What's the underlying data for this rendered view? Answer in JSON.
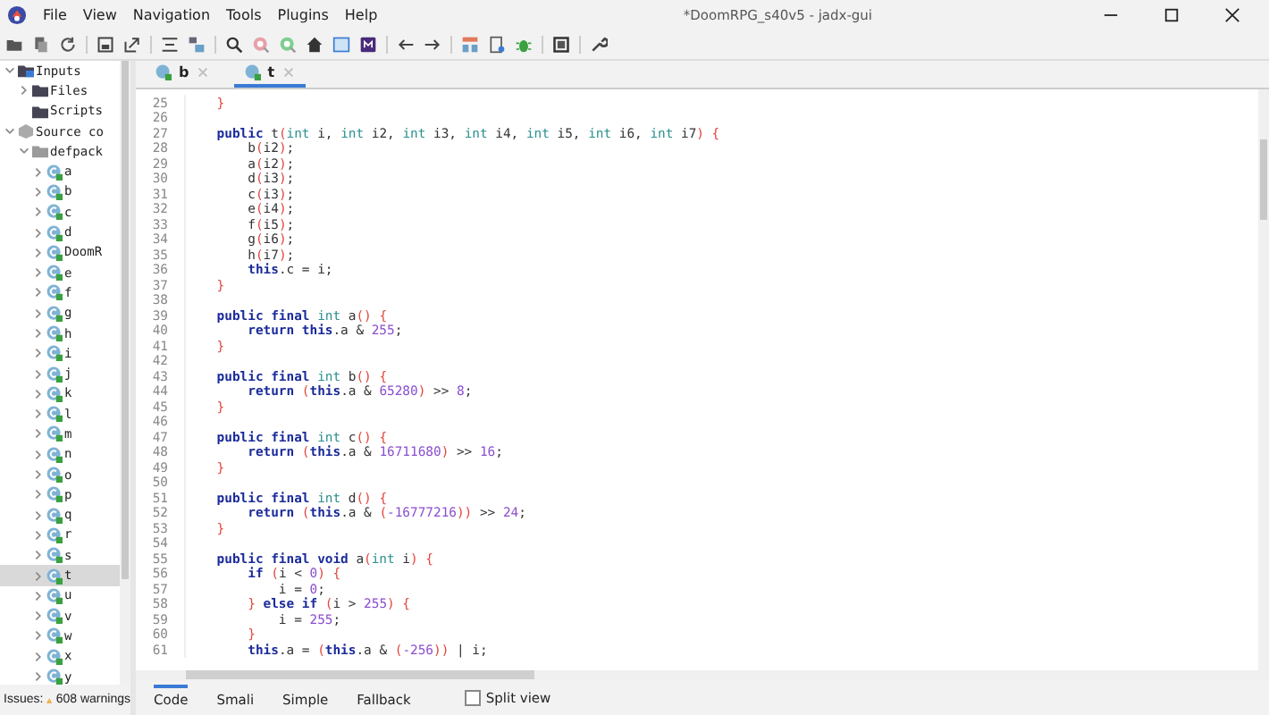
{
  "window": {
    "title": "*DoomRPG_s40v5 - jadx-gui"
  },
  "menu": [
    "File",
    "View",
    "Navigation",
    "Tools",
    "Plugins",
    "Help"
  ],
  "tree": [
    {
      "label": "Inputs",
      "kind": "inputs",
      "expanded": true,
      "selected": false,
      "children": [
        {
          "label": "Files",
          "kind": "folder",
          "expanded": false,
          "selected": false
        },
        {
          "label": "Scripts",
          "kind": "folder",
          "selected": false
        }
      ]
    },
    {
      "label": "Source co",
      "kind": "source",
      "expanded": true,
      "selected": false,
      "children": [
        {
          "label": "defpack",
          "kind": "package",
          "expanded": true,
          "selected": false,
          "children": [
            {
              "label": "a",
              "kind": "class",
              "expanded": false,
              "selected": false
            },
            {
              "label": "b",
              "kind": "class",
              "expanded": false,
              "selected": false
            },
            {
              "label": "c",
              "kind": "class",
              "expanded": false,
              "selected": false
            },
            {
              "label": "d",
              "kind": "class",
              "expanded": false,
              "selected": false
            },
            {
              "label": "DoomR",
              "kind": "class",
              "expanded": false,
              "selected": false
            },
            {
              "label": "e",
              "kind": "class",
              "expanded": false,
              "selected": false
            },
            {
              "label": "f",
              "kind": "class",
              "expanded": false,
              "selected": false
            },
            {
              "label": "g",
              "kind": "class",
              "expanded": false,
              "selected": false
            },
            {
              "label": "h",
              "kind": "class",
              "expanded": false,
              "selected": false
            },
            {
              "label": "i",
              "kind": "class",
              "expanded": false,
              "selected": false
            },
            {
              "label": "j",
              "kind": "class",
              "expanded": false,
              "selected": false
            },
            {
              "label": "k",
              "kind": "class",
              "expanded": false,
              "selected": false
            },
            {
              "label": "l",
              "kind": "class",
              "expanded": false,
              "selected": false
            },
            {
              "label": "m",
              "kind": "class",
              "expanded": false,
              "selected": false
            },
            {
              "label": "n",
              "kind": "class",
              "expanded": false,
              "selected": false
            },
            {
              "label": "o",
              "kind": "class",
              "expanded": false,
              "selected": false
            },
            {
              "label": "p",
              "kind": "class",
              "expanded": false,
              "selected": false
            },
            {
              "label": "q",
              "kind": "class",
              "expanded": false,
              "selected": false
            },
            {
              "label": "r",
              "kind": "class",
              "expanded": false,
              "selected": false
            },
            {
              "label": "s",
              "kind": "class",
              "expanded": false,
              "selected": false
            },
            {
              "label": "t",
              "kind": "class",
              "expanded": false,
              "selected": true
            },
            {
              "label": "u",
              "kind": "class",
              "expanded": false,
              "selected": false
            },
            {
              "label": "v",
              "kind": "class",
              "expanded": false,
              "selected": false
            },
            {
              "label": "w",
              "kind": "class",
              "expanded": false,
              "selected": false
            },
            {
              "label": "x",
              "kind": "class",
              "expanded": false,
              "selected": false
            },
            {
              "label": "y",
              "kind": "class",
              "expanded": false,
              "selected": false
            }
          ]
        }
      ]
    }
  ],
  "status_bar": {
    "label": "Issues:",
    "warnings": "608 warnings"
  },
  "editor_tabs": [
    {
      "label": "b",
      "selected": false
    },
    {
      "label": "t",
      "selected": true
    }
  ],
  "code": [
    {
      "n": "25",
      "tokens": [
        {
          "kind": "bracket",
          "text": "    }"
        }
      ]
    },
    {
      "n": "26"
    },
    {
      "n": "27",
      "tokens": [
        {
          "kind": "keyword",
          "text": "    public"
        },
        {
          "kind": "plain",
          "text": " t"
        },
        {
          "kind": "bracket",
          "text": "("
        },
        {
          "kind": "type",
          "text": "int"
        },
        {
          "kind": "plain",
          "text": " i, "
        },
        {
          "kind": "type",
          "text": "int"
        },
        {
          "kind": "plain",
          "text": " i2, "
        },
        {
          "kind": "type",
          "text": "int"
        },
        {
          "kind": "plain",
          "text": " i3, "
        },
        {
          "kind": "type",
          "text": "int"
        },
        {
          "kind": "plain",
          "text": " i4, "
        },
        {
          "kind": "type",
          "text": "int"
        },
        {
          "kind": "plain",
          "text": " i5, "
        },
        {
          "kind": "type",
          "text": "int"
        },
        {
          "kind": "plain",
          "text": " i6, "
        },
        {
          "kind": "type",
          "text": "int"
        },
        {
          "kind": "plain",
          "text": " i7"
        },
        {
          "kind": "bracket",
          "text": ") {"
        }
      ]
    },
    {
      "n": "28",
      "tokens": [
        {
          "kind": "plain",
          "text": "        b"
        },
        {
          "kind": "bracket",
          "text": "("
        },
        {
          "kind": "plain",
          "text": "i2"
        },
        {
          "kind": "bracket",
          "text": ")"
        },
        {
          "kind": "plain",
          "text": ";"
        }
      ]
    },
    {
      "n": "29",
      "tokens": [
        {
          "kind": "plain",
          "text": "        a"
        },
        {
          "kind": "bracket",
          "text": "("
        },
        {
          "kind": "plain",
          "text": "i2"
        },
        {
          "kind": "bracket",
          "text": ")"
        },
        {
          "kind": "plain",
          "text": ";"
        }
      ]
    },
    {
      "n": "30",
      "tokens": [
        {
          "kind": "plain",
          "text": "        d"
        },
        {
          "kind": "bracket",
          "text": "("
        },
        {
          "kind": "plain",
          "text": "i3"
        },
        {
          "kind": "bracket",
          "text": ")"
        },
        {
          "kind": "plain",
          "text": ";"
        }
      ]
    },
    {
      "n": "31",
      "tokens": [
        {
          "kind": "plain",
          "text": "        c"
        },
        {
          "kind": "bracket",
          "text": "("
        },
        {
          "kind": "plain",
          "text": "i3"
        },
        {
          "kind": "bracket",
          "text": ")"
        },
        {
          "kind": "plain",
          "text": ";"
        }
      ]
    },
    {
      "n": "32",
      "tokens": [
        {
          "kind": "plain",
          "text": "        e"
        },
        {
          "kind": "bracket",
          "text": "("
        },
        {
          "kind": "plain",
          "text": "i4"
        },
        {
          "kind": "bracket",
          "text": ")"
        },
        {
          "kind": "plain",
          "text": ";"
        }
      ]
    },
    {
      "n": "33",
      "tokens": [
        {
          "kind": "plain",
          "text": "        f"
        },
        {
          "kind": "bracket",
          "text": "("
        },
        {
          "kind": "plain",
          "text": "i5"
        },
        {
          "kind": "bracket",
          "text": ")"
        },
        {
          "kind": "plain",
          "text": ";"
        }
      ]
    },
    {
      "n": "34",
      "tokens": [
        {
          "kind": "plain",
          "text": "        g"
        },
        {
          "kind": "bracket",
          "text": "("
        },
        {
          "kind": "plain",
          "text": "i6"
        },
        {
          "kind": "bracket",
          "text": ")"
        },
        {
          "kind": "plain",
          "text": ";"
        }
      ]
    },
    {
      "n": "35",
      "tokens": [
        {
          "kind": "plain",
          "text": "        h"
        },
        {
          "kind": "bracket",
          "text": "("
        },
        {
          "kind": "plain",
          "text": "i7"
        },
        {
          "kind": "bracket",
          "text": ")"
        },
        {
          "kind": "plain",
          "text": ";"
        }
      ]
    },
    {
      "n": "36",
      "tokens": [
        {
          "kind": "keyword",
          "text": "        this"
        },
        {
          "kind": "plain",
          "text": ".c = i;"
        }
      ]
    },
    {
      "n": "37",
      "tokens": [
        {
          "kind": "bracket",
          "text": "    }"
        }
      ]
    },
    {
      "n": "38"
    },
    {
      "n": "39",
      "tokens": [
        {
          "kind": "keyword",
          "text": "    public final"
        },
        {
          "kind": "type",
          "text": " int"
        },
        {
          "kind": "plain",
          "text": " a"
        },
        {
          "kind": "bracket",
          "text": "() {"
        }
      ]
    },
    {
      "n": "40",
      "tokens": [
        {
          "kind": "keyword",
          "text": "        return this"
        },
        {
          "kind": "plain",
          "text": ".a & "
        },
        {
          "kind": "number",
          "text": "255"
        },
        {
          "kind": "plain",
          "text": ";"
        }
      ]
    },
    {
      "n": "41",
      "tokens": [
        {
          "kind": "bracket",
          "text": "    }"
        }
      ]
    },
    {
      "n": "42"
    },
    {
      "n": "43",
      "tokens": [
        {
          "kind": "keyword",
          "text": "    public final"
        },
        {
          "kind": "type",
          "text": " int"
        },
        {
          "kind": "plain",
          "text": " b"
        },
        {
          "kind": "bracket",
          "text": "() {"
        }
      ]
    },
    {
      "n": "44",
      "tokens": [
        {
          "kind": "keyword",
          "text": "        return"
        },
        {
          "kind": "bracket",
          "text": " ("
        },
        {
          "kind": "keyword",
          "text": "this"
        },
        {
          "kind": "plain",
          "text": ".a & "
        },
        {
          "kind": "number",
          "text": "65280"
        },
        {
          "kind": "bracket",
          "text": ")"
        },
        {
          "kind": "plain",
          "text": " >> "
        },
        {
          "kind": "number",
          "text": "8"
        },
        {
          "kind": "plain",
          "text": ";"
        }
      ]
    },
    {
      "n": "45",
      "tokens": [
        {
          "kind": "bracket",
          "text": "    }"
        }
      ]
    },
    {
      "n": "46"
    },
    {
      "n": "47",
      "tokens": [
        {
          "kind": "keyword",
          "text": "    public final"
        },
        {
          "kind": "type",
          "text": " int"
        },
        {
          "kind": "plain",
          "text": " c"
        },
        {
          "kind": "bracket",
          "text": "() {"
        }
      ]
    },
    {
      "n": "48",
      "tokens": [
        {
          "kind": "keyword",
          "text": "        return"
        },
        {
          "kind": "bracket",
          "text": " ("
        },
        {
          "kind": "keyword",
          "text": "this"
        },
        {
          "kind": "plain",
          "text": ".a & "
        },
        {
          "kind": "number",
          "text": "16711680"
        },
        {
          "kind": "bracket",
          "text": ")"
        },
        {
          "kind": "plain",
          "text": " >> "
        },
        {
          "kind": "number",
          "text": "16"
        },
        {
          "kind": "plain",
          "text": ";"
        }
      ]
    },
    {
      "n": "49",
      "tokens": [
        {
          "kind": "bracket",
          "text": "    }"
        }
      ]
    },
    {
      "n": "50"
    },
    {
      "n": "51",
      "tokens": [
        {
          "kind": "keyword",
          "text": "    public final"
        },
        {
          "kind": "type",
          "text": " int"
        },
        {
          "kind": "plain",
          "text": " d"
        },
        {
          "kind": "bracket",
          "text": "() {"
        }
      ]
    },
    {
      "n": "52",
      "tokens": [
        {
          "kind": "keyword",
          "text": "        return"
        },
        {
          "kind": "bracket",
          "text": " ("
        },
        {
          "kind": "keyword",
          "text": "this"
        },
        {
          "kind": "plain",
          "text": ".a & "
        },
        {
          "kind": "bracket",
          "text": "("
        },
        {
          "kind": "number",
          "text": "-16777216"
        },
        {
          "kind": "bracket",
          "text": "))"
        },
        {
          "kind": "plain",
          "text": " >> "
        },
        {
          "kind": "number",
          "text": "24"
        },
        {
          "kind": "plain",
          "text": ";"
        }
      ]
    },
    {
      "n": "53",
      "tokens": [
        {
          "kind": "bracket",
          "text": "    }"
        }
      ]
    },
    {
      "n": "54"
    },
    {
      "n": "55",
      "tokens": [
        {
          "kind": "keyword",
          "text": "    public final void"
        },
        {
          "kind": "plain",
          "text": " a"
        },
        {
          "kind": "bracket",
          "text": "("
        },
        {
          "kind": "type",
          "text": "int"
        },
        {
          "kind": "plain",
          "text": " i"
        },
        {
          "kind": "bracket",
          "text": ") {"
        }
      ]
    },
    {
      "n": "56",
      "tokens": [
        {
          "kind": "keyword",
          "text": "        if"
        },
        {
          "kind": "bracket",
          "text": " ("
        },
        {
          "kind": "plain",
          "text": "i < "
        },
        {
          "kind": "number",
          "text": "0"
        },
        {
          "kind": "bracket",
          "text": ") {"
        }
      ]
    },
    {
      "n": "57",
      "tokens": [
        {
          "kind": "plain",
          "text": "            i = "
        },
        {
          "kind": "number",
          "text": "0"
        },
        {
          "kind": "plain",
          "text": ";"
        }
      ]
    },
    {
      "n": "58",
      "tokens": [
        {
          "kind": "bracket",
          "text": "        }"
        },
        {
          "kind": "keyword",
          "text": " else if"
        },
        {
          "kind": "bracket",
          "text": " ("
        },
        {
          "kind": "plain",
          "text": "i > "
        },
        {
          "kind": "number",
          "text": "255"
        },
        {
          "kind": "bracket",
          "text": ") {"
        }
      ]
    },
    {
      "n": "59",
      "tokens": [
        {
          "kind": "plain",
          "text": "            i = "
        },
        {
          "kind": "number",
          "text": "255"
        },
        {
          "kind": "plain",
          "text": ";"
        }
      ]
    },
    {
      "n": "60",
      "tokens": [
        {
          "kind": "bracket",
          "text": "        }"
        }
      ]
    },
    {
      "n": "61",
      "tokens": [
        {
          "kind": "keyword",
          "text": "        this"
        },
        {
          "kind": "plain",
          "text": ".a = "
        },
        {
          "kind": "bracket",
          "text": "("
        },
        {
          "kind": "keyword",
          "text": "this"
        },
        {
          "kind": "plain",
          "text": ".a & "
        },
        {
          "kind": "bracket",
          "text": "("
        },
        {
          "kind": "number",
          "text": "-256"
        },
        {
          "kind": "bracket",
          "text": "))"
        },
        {
          "kind": "plain",
          "text": " | i;"
        }
      ]
    }
  ],
  "bottom_tabs": [
    {
      "label": "Code",
      "selected": true
    },
    {
      "label": "Smali",
      "selected": false
    },
    {
      "label": "Simple",
      "selected": false
    },
    {
      "label": "Fallback",
      "selected": false
    }
  ],
  "split_view": {
    "label": "Split view",
    "checked": false
  }
}
